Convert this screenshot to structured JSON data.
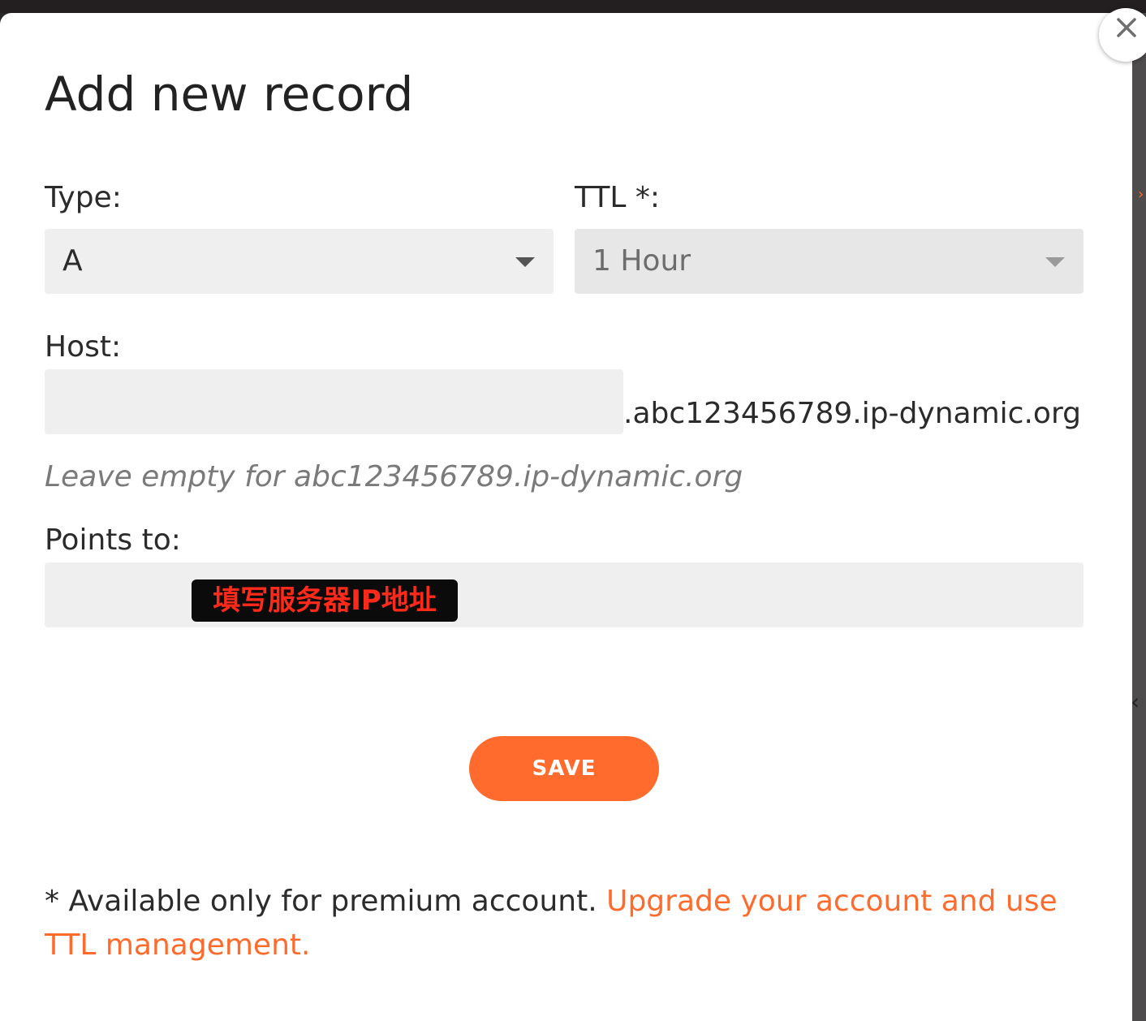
{
  "modal": {
    "title": "Add new record",
    "type_label": "Type:",
    "type_value": "A",
    "ttl_label": "TTL *:",
    "ttl_value": "1 Hour",
    "host_label": "Host:",
    "host_value": "",
    "host_suffix": ".abc123456789.ip-dynamic.org",
    "host_hint": "Leave empty for abc123456789.ip-dynamic.org",
    "points_to_label": "Points to:",
    "points_to_value": "",
    "points_to_annotation": "填写服务器IP地址",
    "save_label": "SAVE",
    "footnote_text": "* Available only for premium account. ",
    "footnote_link": "Upgrade your account and use TTL management."
  },
  "icons": {
    "close": "close-icon",
    "type_caret": "chevron-down-icon",
    "ttl_caret": "chevron-down-icon"
  },
  "colors": {
    "accent": "#ff6b2c",
    "field_background": "#efefef",
    "annotation_text": "#ff2a1a"
  }
}
